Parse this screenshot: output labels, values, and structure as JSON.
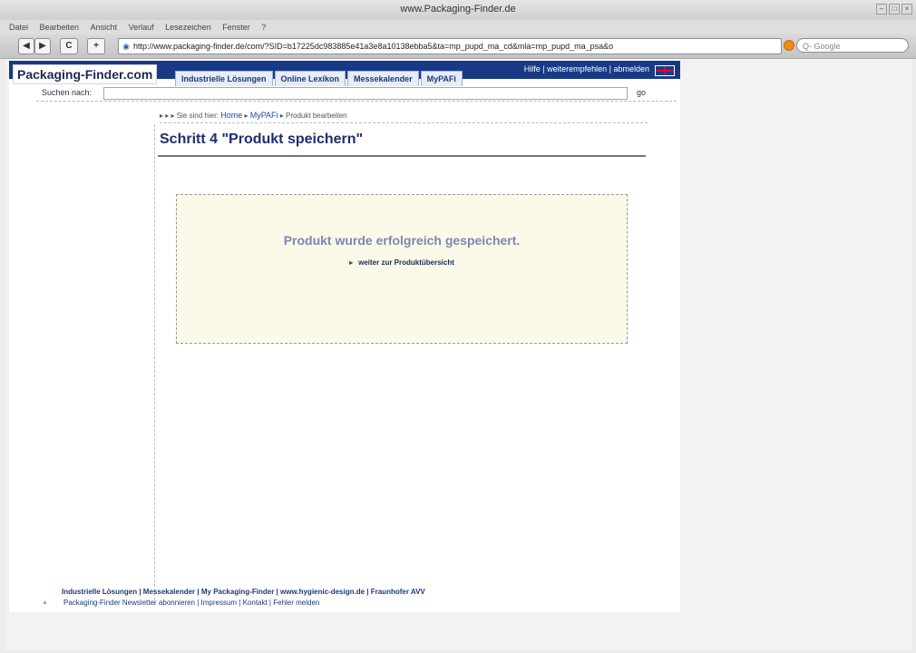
{
  "window": {
    "title": "www.Packaging-Finder.de"
  },
  "menu": [
    "Datei",
    "Bearbeiten",
    "Ansicht",
    "Verlauf",
    "Lesezeichen",
    "Fenster",
    "?"
  ],
  "toolbar": {
    "back": "◀",
    "forward": "▶",
    "reload": "C",
    "add": "+",
    "url": "http://www.packaging-finder.de/com/?SID=b17225dc983885e41a3e8a10138ebba5&ta=mp_pupd_ma_cd&mla=mp_pupd_ma_psa&o",
    "search_placeholder": "Q- Google"
  },
  "site": {
    "logo": "Packaging-Finder.com",
    "tabs": [
      "Industrielle Lösungen",
      "Online Lexikon",
      "Messekalender",
      "MyPAFi"
    ],
    "top_links": "Hilfe | weiterempfehlen | abmelden",
    "search_label": "Suchen nach:",
    "search_value": "",
    "go_label": "go"
  },
  "breadcrumb": {
    "prefix": "▸ ▸ ▸ Sie sind hier:",
    "home": "Home",
    "mypafi": "MyPAFi",
    "current": "Produkt bearbeiten",
    "sep": "▸"
  },
  "page": {
    "heading": "Schritt 4 \"Produkt speichern\"",
    "success_message": "Produkt wurde erfolgreich gespeichert.",
    "continue_arrow": "▸",
    "continue_link": "weiter zur Produktübersicht"
  },
  "footer": {
    "line1": "Industrielle Lösungen | Messekalender | My Packaging-Finder | www.hygienic-design.de | Fraunhofer AVV",
    "line2": "Packaging-Finder Newsletter abonnieren | Impressum | Kontakt | Fehler melden",
    "up_arrow": "▲"
  }
}
